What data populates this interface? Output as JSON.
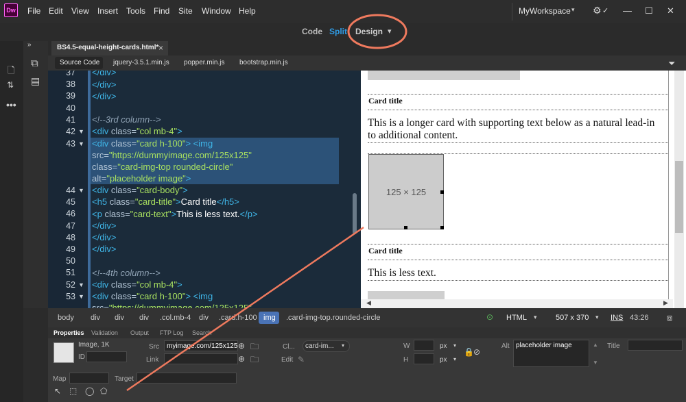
{
  "app": {
    "logo": "Dw",
    "menus": [
      "File",
      "Edit",
      "View",
      "Insert",
      "Tools",
      "Find",
      "Site",
      "Window",
      "Help"
    ],
    "workspace": "MyWorkspace",
    "window_controls": {
      "minimize": "—",
      "maximize": "☐",
      "close": "✕"
    }
  },
  "viewbar": {
    "code": "Code",
    "split": "Split",
    "design": "Design",
    "design_arrow": "▾"
  },
  "doc": {
    "tab": "BS4.5-equal-height-cards.html*",
    "close": "×",
    "related": [
      "jquery-3.5.1.min.js",
      "popper.min.js",
      "bootstrap.min.js"
    ],
    "source": "Source Code"
  },
  "code": {
    "line_numbers": [
      "37",
      "38",
      "39",
      "40",
      "41",
      "42",
      "43",
      "",
      "",
      "",
      "44",
      "45",
      "46",
      "47",
      "48",
      "49",
      "50",
      "51",
      "52",
      "53"
    ],
    "fold_markers": {
      "42": "▼",
      "43": "▼",
      "44": "▼",
      "52": "▼",
      "53": "▼"
    }
  },
  "design": {
    "card1_title": "Card title",
    "card1_text": "This is a longer card with supporting text below as a natural lead-in to additional content.",
    "placeholder": "125 × 125",
    "card2_title": "Card title",
    "card2_text": "This is less text."
  },
  "statusbar": {
    "crumbs": [
      "body",
      "div",
      "div",
      "div",
      ".col.mb-4",
      "div",
      ".card.h-100",
      "img",
      ".card-img-top.rounded-circle"
    ],
    "language": "HTML",
    "dimensions": "507 x 370",
    "mode": "INS",
    "position": "43:26"
  },
  "properties": {
    "tabs": [
      "Properties",
      "Validation",
      "Output",
      "FTP Log",
      "Search"
    ],
    "image_label": "Image, 1K",
    "id_label": "ID",
    "src_label": "Src",
    "src_value": "myimage.com/125x125",
    "link_label": "Link",
    "class_label": "Cl...",
    "class_value": "card-im...",
    "edit_label": "Edit",
    "w_label": "W",
    "h_label": "H",
    "w_unit": "px",
    "h_unit": "px",
    "alt_label": "Alt",
    "alt_value": "placeholder image",
    "title_label": "Title",
    "map_label": "Map",
    "target_label": "Target"
  }
}
